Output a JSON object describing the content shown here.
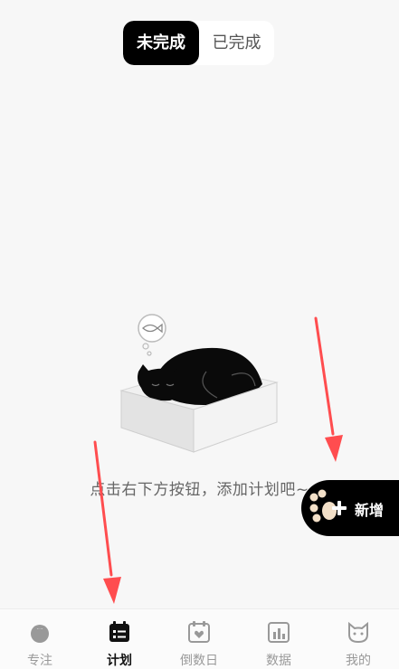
{
  "segment": {
    "active_label": "未完成",
    "inactive_label": "已完成"
  },
  "empty_state": {
    "message": "点击右下方按钮，添加计划吧~"
  },
  "fab": {
    "label": "新增"
  },
  "tabbar": {
    "tabs": [
      {
        "label": "专注",
        "icon": "tomato-icon"
      },
      {
        "label": "计划",
        "icon": "calendar-list-icon",
        "active": true
      },
      {
        "label": "倒数日",
        "icon": "calendar-heart-icon"
      },
      {
        "label": "数据",
        "icon": "bar-chart-icon"
      },
      {
        "label": "我的",
        "icon": "cat-face-icon"
      }
    ]
  },
  "colors": {
    "background": "#f7f7f7",
    "accent": "#000000",
    "arrow": "#ff4d4f"
  }
}
